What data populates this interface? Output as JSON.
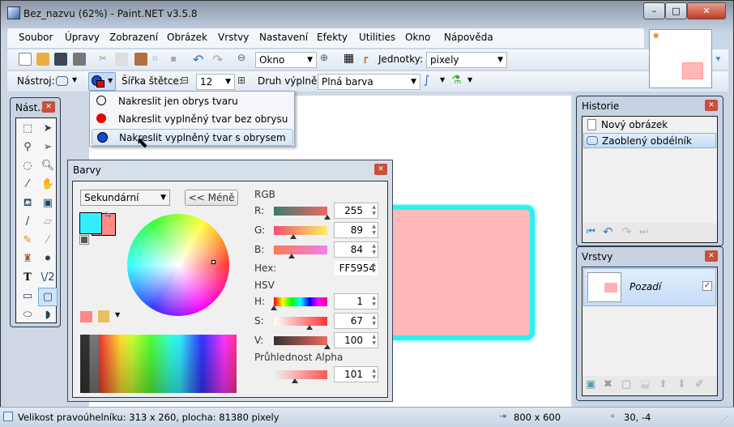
{
  "window": {
    "title": "Bez_nazvu (62%) - Paint.NET v3.5.8",
    "controls": [
      "minimize",
      "maximize",
      "close"
    ]
  },
  "menu": [
    "Soubor",
    "Úpravy",
    "Zobrazení",
    "Obrázek",
    "Vrstvy",
    "Nastavení",
    "Efekty",
    "Utilities",
    "Okno",
    "Nápověda"
  ],
  "toolbar1": {
    "zoom_value": "Okno",
    "units_label": "Jednotky:",
    "units_value": "pixely"
  },
  "toolbar2": {
    "tool_label": "Nástroj:",
    "brush_label": "Šířka štětce:",
    "brush_value": "12",
    "fill_label": "Druh výplně:",
    "fill_value": "Plná barva"
  },
  "dropdown": {
    "items": [
      "Nakreslit jen obrys tvaru",
      "Nakreslit vyplněný tvar bez obrysu",
      "Nakreslit vyplněný tvar s obrysem"
    ],
    "highlighted": 2
  },
  "tools_panel": {
    "title": "Nást..."
  },
  "colors_panel": {
    "title": "Barvy",
    "mode": "Sekundární",
    "less_button": "<< Méně",
    "primary_color": "#33eeff",
    "secondary_color": "#ff5954",
    "rgb_label": "RGB",
    "r_label": "R:",
    "r": "255",
    "g_label": "G:",
    "g": "89",
    "b_label": "B:",
    "b": "84",
    "hex_label": "Hex:",
    "hex": "FF5954",
    "hsv_label": "HSV",
    "h_label": "H:",
    "h": "1",
    "s_label": "S:",
    "s": "67",
    "v_label": "V:",
    "v": "100",
    "alpha_label": "Průhlednost Alpha",
    "alpha": "101"
  },
  "history": {
    "title": "Historie",
    "items": [
      "Nový obrázek",
      "Zaoblený obdélník"
    ]
  },
  "layers": {
    "title": "Vrstvy",
    "items": [
      "Pozadí"
    ]
  },
  "status": {
    "text": "Velikost pravoúhelníku: 313 x 260, plocha: 81380 pixely",
    "image_size": "800 x 600",
    "cursor": "30, -4"
  }
}
